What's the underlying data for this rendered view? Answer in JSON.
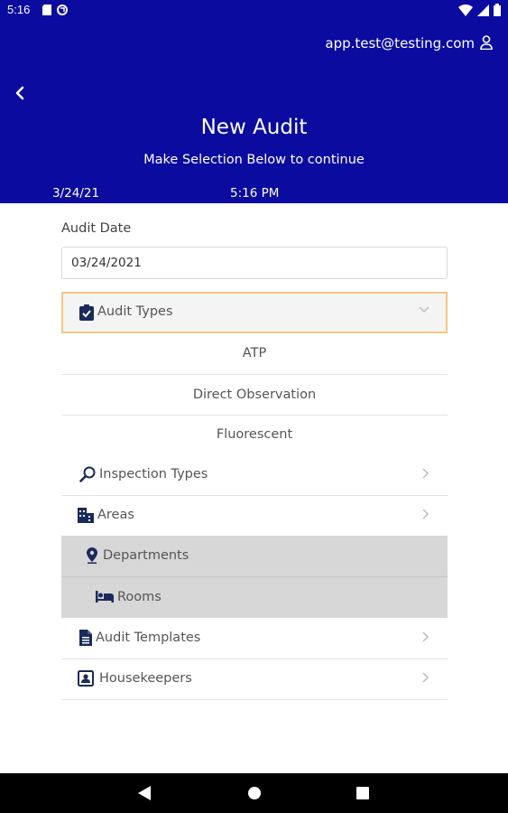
{
  "status_bar": {
    "time": "5:16"
  },
  "header": {
    "user_email": "app.test@testing.com",
    "title": "New Audit",
    "subtitle": "Make Selection Below to continue",
    "date": "3/24/21",
    "time": "5:16 PM"
  },
  "form": {
    "audit_date_label": "Audit Date",
    "audit_date_value": "03/24/2021",
    "audit_types_label": "Audit Types",
    "audit_type_options": [
      "ATP",
      "Direct Observation",
      "Fluorescent"
    ]
  },
  "menu": {
    "inspection_types": "Inspection Types",
    "areas": "Areas",
    "departments": "Departments",
    "rooms": "Rooms",
    "audit_templates": "Audit Templates",
    "housekeepers": "Housekeepers"
  },
  "colors": {
    "header_bg": "#0b0b9f",
    "highlight_border": "#f1c981",
    "disabled_row_bg": "#d7d7d7",
    "icon_color": "#1a2a5a"
  }
}
